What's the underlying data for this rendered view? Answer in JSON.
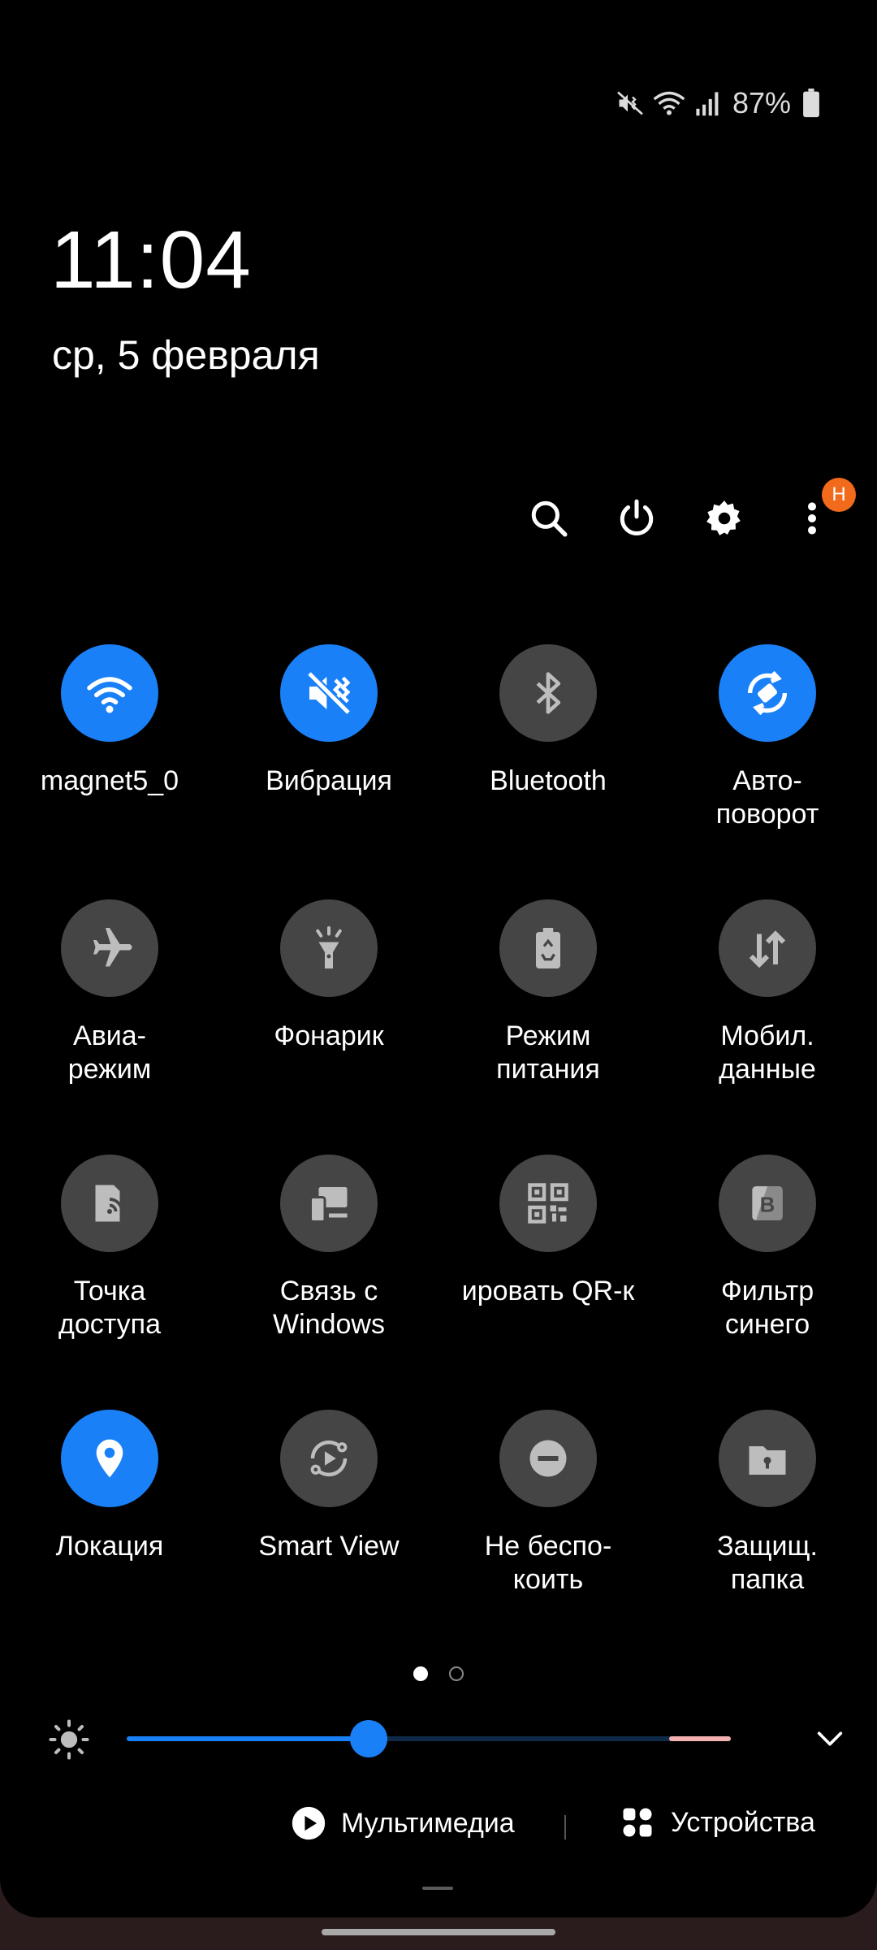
{
  "status_bar": {
    "battery_percent": "87%",
    "icons": [
      "mute-vibrate-icon",
      "wifi-icon",
      "signal-icon",
      "battery-icon"
    ]
  },
  "clock": {
    "time": "11:04",
    "date": "ср, 5 февраля"
  },
  "top_actions": {
    "icons": [
      "search-icon",
      "power-icon",
      "settings-icon",
      "more-icon"
    ],
    "notification_badge": "H"
  },
  "tiles": [
    {
      "label": "magnet5_0",
      "icon": "wifi-icon",
      "active": true
    },
    {
      "label": "Вибрация",
      "icon": "vibrate-icon",
      "active": true
    },
    {
      "label": "Bluetooth",
      "icon": "bluetooth-icon",
      "active": false
    },
    {
      "label": "Авто-\nповорот",
      "icon": "auto-rotate-icon",
      "active": true
    },
    {
      "label": "Авиа-\nрежим",
      "icon": "airplane-icon",
      "active": false
    },
    {
      "label": "Фонарик",
      "icon": "flashlight-icon",
      "active": false
    },
    {
      "label": "Режим\nпитания",
      "icon": "power-mode-icon",
      "active": false
    },
    {
      "label": "Мобил.\nданные",
      "icon": "mobile-data-icon",
      "active": false
    },
    {
      "label": "Точка\nдоступа",
      "icon": "hotspot-icon",
      "active": false
    },
    {
      "label": "Связь с\nWindows",
      "icon": "link-windows-icon",
      "active": false
    },
    {
      "label": "ировать QR-к",
      "icon": "qr-icon",
      "active": false
    },
    {
      "label": "Фильтр\nсинего",
      "icon": "blue-filter-icon",
      "active": false
    },
    {
      "label": "Локация",
      "icon": "location-icon",
      "active": true
    },
    {
      "label": "Smart View",
      "icon": "smart-view-icon",
      "active": false
    },
    {
      "label": "Не беспо-\nкоить",
      "icon": "do-not-disturb-icon",
      "active": false
    },
    {
      "label": "Защищ.\nпапка",
      "icon": "secure-folder-icon",
      "active": false
    }
  ],
  "pager": {
    "current": 1,
    "total": 2
  },
  "brightness": {
    "level": 0.4
  },
  "bottom": {
    "media_label": "Мультимедиа",
    "devices_label": "Устройства"
  },
  "colors": {
    "accent": "#1a80f7",
    "tile_inactive": "#454545",
    "badge": "#f26a1b",
    "background": "#000000"
  }
}
